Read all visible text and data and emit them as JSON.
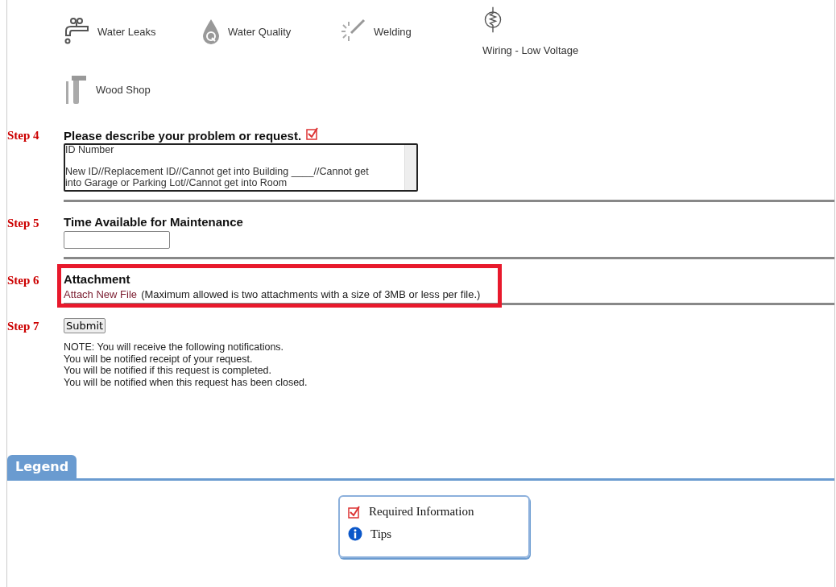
{
  "categories": [
    {
      "label": "Water Leaks"
    },
    {
      "label": "Water Quality"
    },
    {
      "label": "Welding"
    },
    {
      "label": "Wiring - Low Voltage"
    },
    {
      "label": "Wood Shop"
    }
  ],
  "steps": [
    {
      "kind": "textarea",
      "step": "Step 4",
      "title": "Please describe your problem or request.",
      "required": true,
      "highlighted": false,
      "value": "ID Number\n\nNew ID//Replacement ID//Cannot get into Building ____//Cannot get\ninto Garage or Parking Lot//Cannot get into Room"
    },
    {
      "kind": "input",
      "step": "Step 5",
      "title": "Time Available for Maintenance",
      "required": false,
      "highlighted": false
    },
    {
      "kind": "attachment",
      "step": "Step 6",
      "title": "Attachment",
      "required": false,
      "highlighted": true,
      "link": "Attach New File",
      "note": "(Maximum allowed is two attachments with a size of 3MB or less per file.)"
    },
    {
      "kind": "submit",
      "step": "Step 7",
      "button": "Submit",
      "required": false,
      "highlighted": false,
      "notes": [
        "NOTE: You will receive the following notifications.",
        "You will be notified receipt of your request.",
        "You will be notified if this request is completed.",
        "You will be notified when this request has been closed."
      ]
    }
  ],
  "legend": {
    "tab": "Legend",
    "items": [
      {
        "kind": "required",
        "label": "Required Information"
      },
      {
        "kind": "tip",
        "label": "Tips"
      }
    ]
  }
}
